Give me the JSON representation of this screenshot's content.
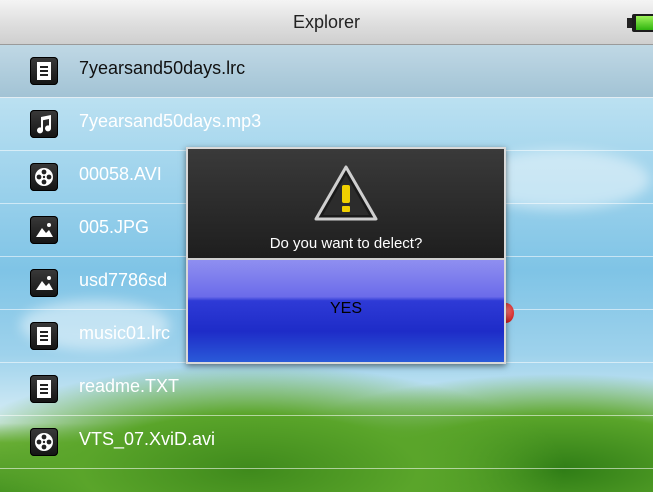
{
  "header": {
    "title": "Explorer",
    "battery_icon": "battery-icon"
  },
  "files": [
    {
      "name": "7yearsand50days.lrc",
      "icon": "document-icon",
      "selected": true
    },
    {
      "name": "7yearsand50days.mp3",
      "icon": "music-icon",
      "selected": false
    },
    {
      "name": "00058.AVI",
      "icon": "film-reel-icon",
      "selected": false
    },
    {
      "name": "005.JPG",
      "icon": "picture-icon",
      "selected": false
    },
    {
      "name": "usd7786sd",
      "icon": "picture-icon",
      "selected": false
    },
    {
      "name": "music01.lrc",
      "icon": "document-icon",
      "selected": false
    },
    {
      "name": "readme.TXT",
      "icon": "document-icon",
      "selected": false
    },
    {
      "name": "VTS_07.XviD.avi",
      "icon": "film-reel-icon",
      "selected": false
    }
  ],
  "dialog": {
    "message": "Do you want to delect?",
    "yes_label": "YES",
    "icon": "warning-icon"
  },
  "colors": {
    "accent": "#2e3ad6",
    "selected_row": "#a0c0d2",
    "text": "#ffffff"
  }
}
